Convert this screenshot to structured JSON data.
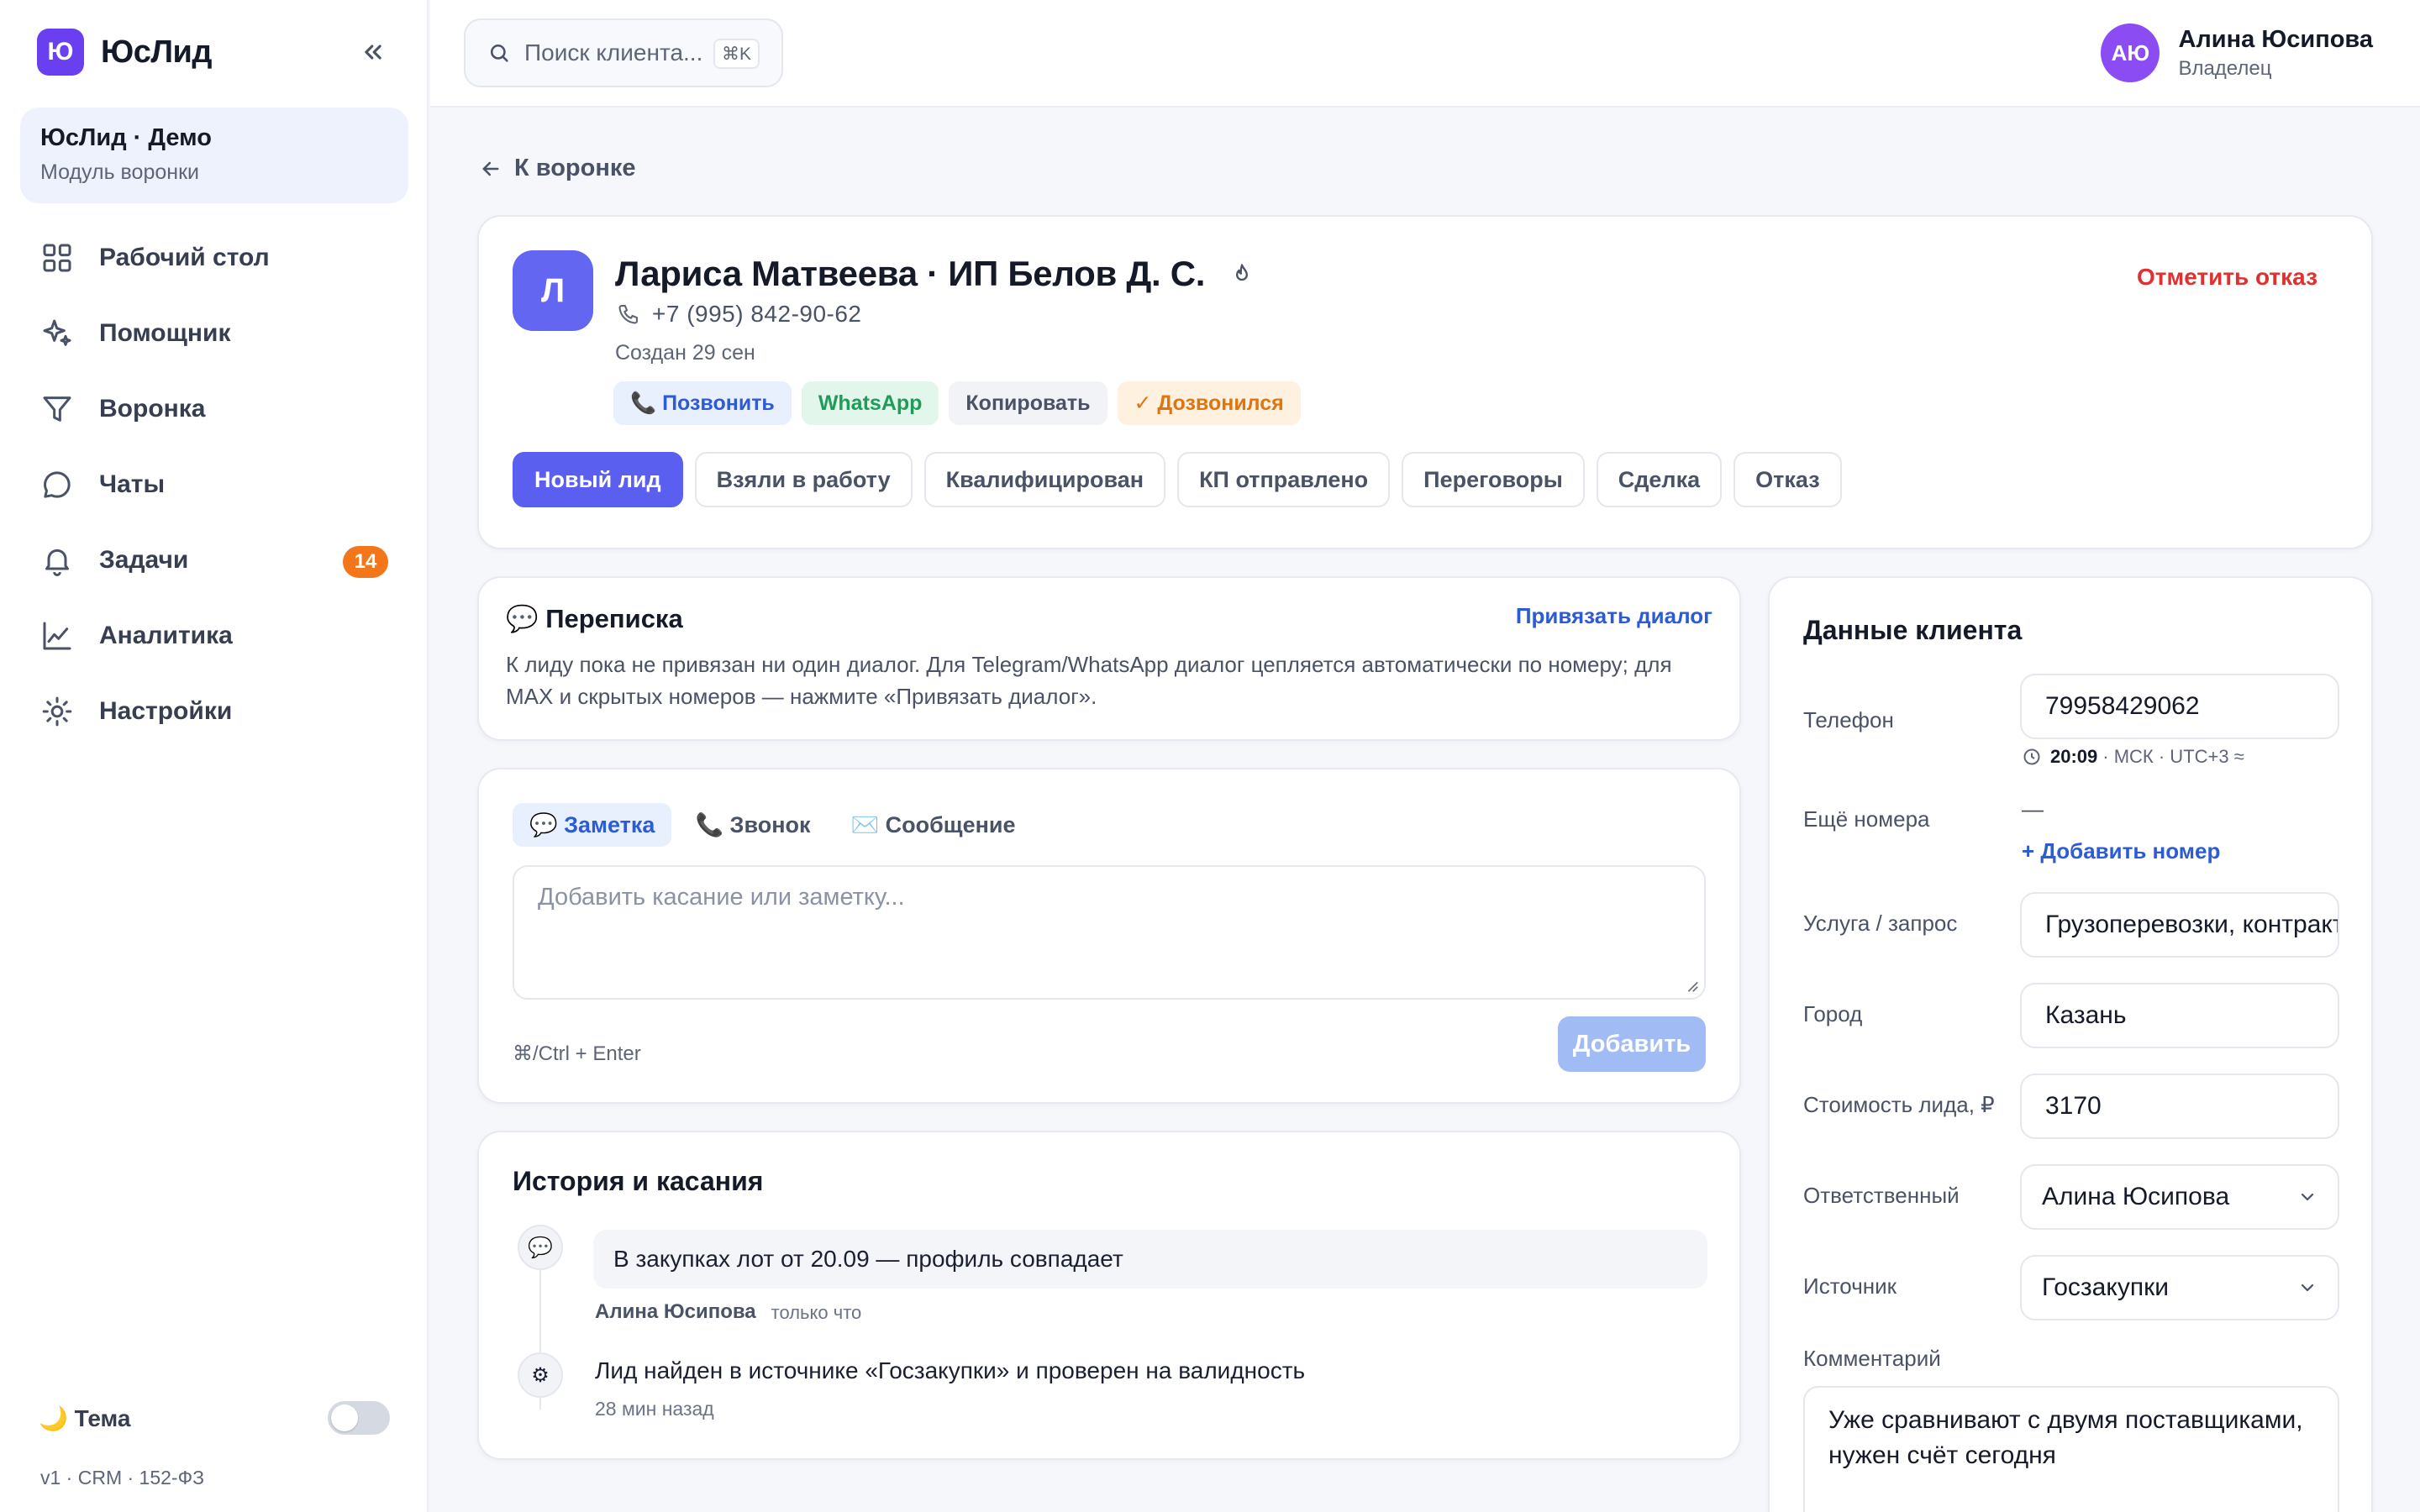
{
  "app": {
    "logo_letter": "Ю",
    "name": "ЮсЛид"
  },
  "workspace": {
    "title": "ЮсЛид · Демо",
    "subtitle": "Модуль воронки"
  },
  "sidebar": {
    "items": [
      {
        "label": "Рабочий стол",
        "icon": "dashboard-grid-icon"
      },
      {
        "label": "Помощник",
        "icon": "sparkle-icon"
      },
      {
        "label": "Воронка",
        "icon": "funnel-icon"
      },
      {
        "label": "Чаты",
        "icon": "chat-bubble-icon"
      },
      {
        "label": "Задачи",
        "icon": "bell-icon",
        "badge": "14"
      },
      {
        "label": "Аналитика",
        "icon": "line-chart-icon"
      },
      {
        "label": "Настройки",
        "icon": "sun-gear-icon"
      }
    ],
    "theme_label": "🌙 Тема",
    "version": "v1 · CRM · 152-ФЗ"
  },
  "topbar": {
    "search_placeholder": "Поиск клиента...",
    "search_shortcut": "⌘K",
    "user": {
      "initials": "АЮ",
      "name": "Алина Юсипова",
      "role": "Владелец"
    }
  },
  "back_link": "К воронке",
  "lead": {
    "avatar_letter": "Л",
    "title": "Лариса Матвеева · ИП Белов Д. С.",
    "phone": "+7 (995) 842-90-62",
    "created": "Создан 29 сен",
    "actions": {
      "call": "📞 Позвонить",
      "whatsapp": "WhatsApp",
      "copy": "Копировать",
      "reached": "✓ Дозвонился"
    },
    "refuse": "Отметить отказ",
    "stages": [
      "Новый лид",
      "Взяли в работу",
      "Квалифицирован",
      "КП отправлено",
      "Переговоры",
      "Сделка",
      "Отказ"
    ],
    "active_stage": "Новый лид"
  },
  "correspondence": {
    "title": "💬 Переписка",
    "link": "Привязать диалог",
    "text": "К лиду пока не привязан ни один диалог. Для Telegram/WhatsApp диалог цепляется автоматически по номеру; для MAX и скрытых номеров — нажмите «Привязать диалог»."
  },
  "compose": {
    "tabs": [
      "💬 Заметка",
      "📞 Звонок",
      "✉️ Сообщение"
    ],
    "placeholder": "Добавить касание или заметку...",
    "hint": "⌘/Ctrl + Enter",
    "submit": "Добавить"
  },
  "history": {
    "title": "История и касания",
    "items": [
      {
        "icon": "💬",
        "text": "В закупках лот от 20.09 — профиль совпадает",
        "author": "Алина Юсипова",
        "time": "только что"
      },
      {
        "icon": "⚙",
        "text": "Лид найден в источнике «Госзакупки» и проверен на валидность",
        "time": "28 мин назад"
      }
    ]
  },
  "client": {
    "title": "Данные клиента",
    "phone_label": "Телефон",
    "phone_value": "79958429062",
    "tz_time": "20:09",
    "tz_rest": "· МСК · UTC+3 ≈",
    "more_label": "Ещё номера",
    "more_value": "—",
    "add_number": "+ Добавить номер",
    "service_label": "Услуга / запрос",
    "service_value": "Грузоперевозки, контракт",
    "city_label": "Город",
    "city_value": "Казань",
    "cost_label": "Стоимость лида, ₽",
    "cost_value": "3170",
    "owner_label": "Ответственный",
    "owner_value": "Алина Юсипова",
    "source_label": "Источник",
    "source_value": "Госзакупки",
    "comment_label": "Комментарий",
    "comment_value": "Уже сравнивают с двумя поставщиками, нужен счёт сегодня"
  }
}
